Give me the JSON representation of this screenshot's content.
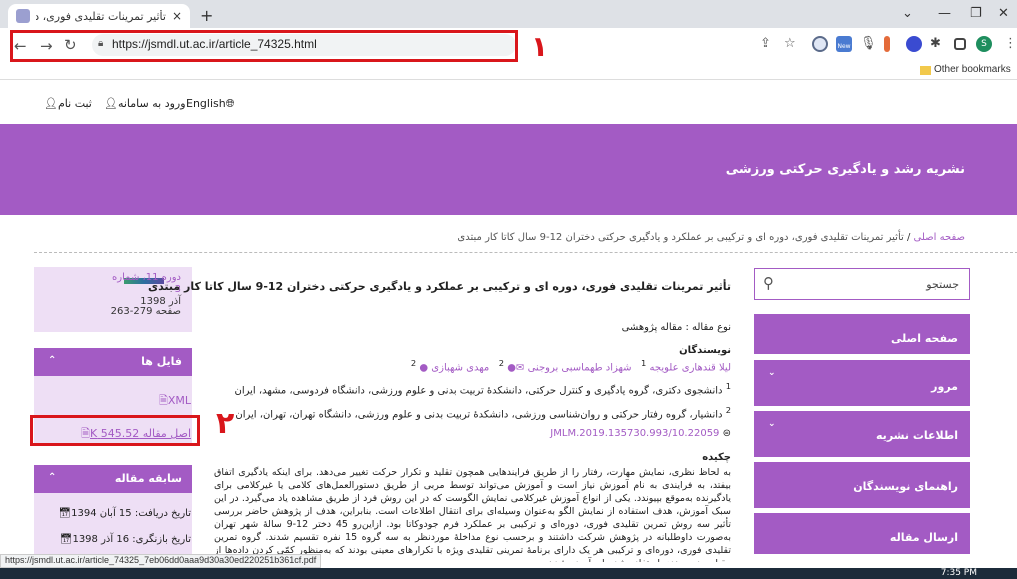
{
  "browser": {
    "tab_title": "تأثیر تمرینات تقلیدی فوری، دوره ای",
    "tab_close": "×",
    "new_tab": "+",
    "url": "https://jsmdl.ut.ac.ir/article_74325.html",
    "bookmarks_label": "Other bookmarks",
    "status_url": "https://jsmdl.ut.ac.ir/article_74325_7eb06dd0aaa9d30a30ed220251b361cf.pdf",
    "clock": "7:35 PM",
    "profile_initial": "S",
    "ext_new": "New",
    "annotation_1": "١",
    "annotation_2": "٢"
  },
  "site": {
    "lang": "English",
    "login": "ورود به سامانه",
    "register": "ثبت نام",
    "journal_title": "نشریه رشد و یادگیری حرکتی ورزشی",
    "breadcrumb_home": "صفحه اصلی",
    "breadcrumb_current": "تأثیر تمرینات تقلیدی فوری، دوره ای و ترکیبی بر عملکرد و یادگیری حرکتی دختران 12-9 سال کاتا کار مبتدی"
  },
  "sidebar": {
    "search_placeholder": "جستجو",
    "items": [
      {
        "label": "صفحه اصلی",
        "chevron": ""
      },
      {
        "label": "مرور",
        "chevron": "⌄"
      },
      {
        "label": "اطلاعات نشریه",
        "chevron": "⌄"
      },
      {
        "label": "راهنمای نویسندگان",
        "chevron": ""
      },
      {
        "label": "ارسال مقاله",
        "chevron": ""
      }
    ]
  },
  "issue": {
    "volume": "دوره 11، شماره",
    "number": "3",
    "date": "آذر 1398",
    "pages": "صفحه 279-263"
  },
  "files": {
    "heading": "فایل ها",
    "xml": "XML",
    "pdf": "اصل مقاله 545.52 K"
  },
  "history": {
    "heading": "سابقه مقاله",
    "received": "تاریخ دریافت: 15 آبان 1394",
    "revised": "تاریخ بازنگری: 16 آذر 1398"
  },
  "article": {
    "title": "تأثیر تمرینات تقلیدی فوری، دوره ای و ترکیبی بر عملکرد و یادگیری حرکتی دختران 12-9 سال کاتا کار مبتدی",
    "type": "نوع مقاله : مقاله پژوهشی",
    "authors_heading": "نویسندگان",
    "author1": "لیلا قندهاری علویجه",
    "author1_sup": "1",
    "author2": "شهزاد طهماسبی بروجنی",
    "author2_sup": "2",
    "author3": "مهدی شهبازی",
    "author3_sup": "2",
    "aff1_sup": "1",
    "aff1": "دانشجوی دکتری، گروه یادگیری و کنترل حرکتی، دانشکدۀ تربیت بدنی و علوم ورزشی، دانشگاه فردوسی، مشهد، ایران",
    "aff2_sup": "2",
    "aff2": "دانشیار، گروه رفتار حرکتی و روان‌شناسی ورزشی، دانشکدۀ تربیت بدنی و علوم ورزشی، دانشگاه تهران، تهران، ایران",
    "doi": "10.22059/JMLM.2019.135730.993",
    "abstract_heading": "چکیده",
    "abstract": "به لحاظ نظری، نمایش مهارت، رفتار را از طریق فرایندهایی همچون تقلید و تکرار حرکت تغییر می‌دهد. برای اینکه یادگیری اتفاق بیفتد، به فرایندی به نام آموزش نیاز است و آموزش می‌تواند توسط مربی از طریق دستورالعمل‌های کلامی یا غیرکلامی برای یادگیرنده به‌موقع بپیوندد. یکی از انواع آموزش غیرکلامی نمایش الگوست که در این روش فرد از طریق مشاهده یاد می‌گیرد. در این سبک آموزش، هدف استفاده از نمایش الگو به‌عنوان وسیله‌ای برای انتقال اطلاعات است. بنابراین، هدف از پژوهش حاضر بررسی تأثیر سه روش تمرین تقلیدی فوری، دوره‌ای و ترکیبی بر عملکرد فرم جودوکاتا بود. ازاین‌رو 45 دختر 12-9 سالۀ شهر تهران به‌صورت داوطلبانه در پژوهش شرکت داشتند و برحسب نوع مداخلۀ موردنظر به سه گروه 15 نفره تقسیم شدند. گروه تمرین تقلیدی فوری، دوره‌ای و ترکیبی هر یک دارای برنامۀ تمرینی تقلیدی ویژه با تکرارهای معینی بودند که به‌منظور کمّی کردن داده‌ها از مقیاس درجه‌بندی استفاده شد. با برآورده شدن"
  }
}
